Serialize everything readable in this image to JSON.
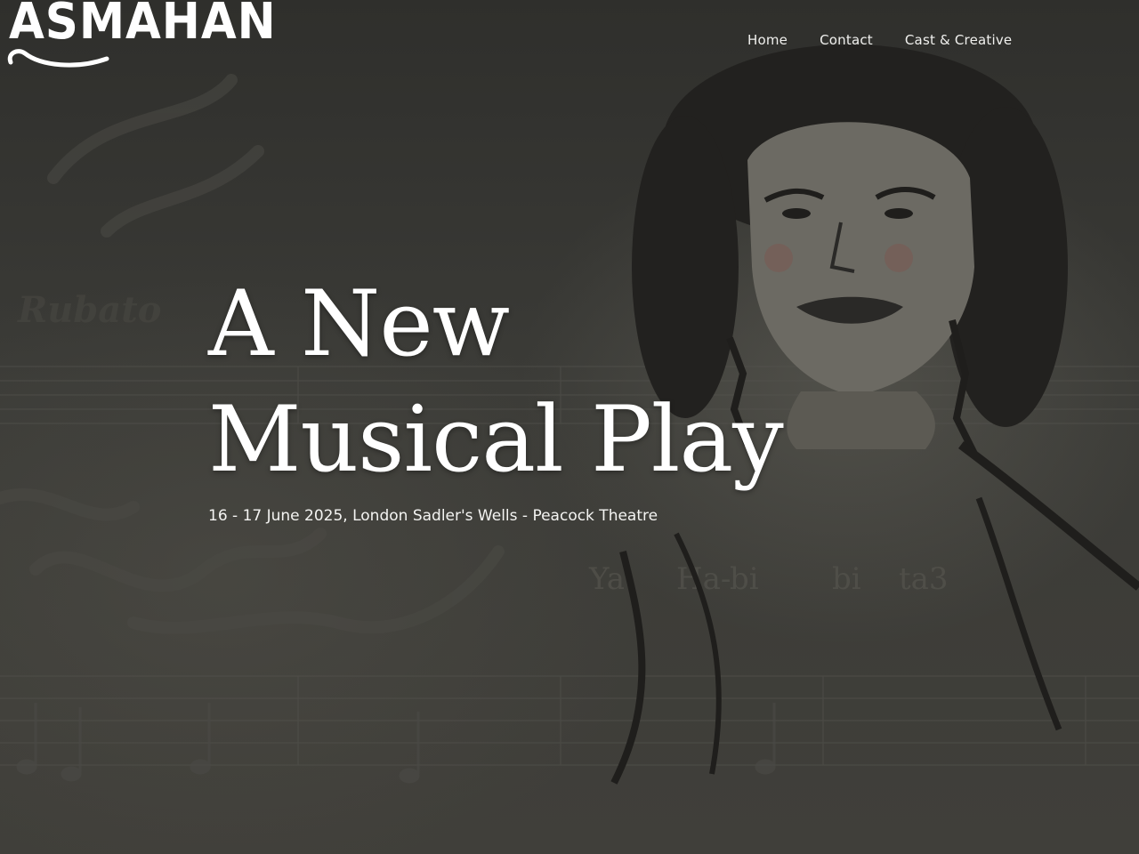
{
  "brand": {
    "logo_text": "ASMAHAN"
  },
  "nav": {
    "items": [
      "Home",
      "Contact",
      "Cast & Creative"
    ]
  },
  "hero": {
    "title_line1": "A New",
    "title_line2": "Musical Play",
    "subtitle": "16 - 17 June 2025, London Sadler's Wells - Peacock Theatre"
  },
  "background_text": {
    "tempo_marking": "Rubato",
    "lyric_syllables": [
      "Ya",
      "Ha-",
      "bi",
      "bi",
      "ta3"
    ]
  },
  "colors": {
    "background": "#3a3a36",
    "text": "#ffffff"
  },
  "icons": [
    "portrait-illustration",
    "music-staff",
    "calligraphy"
  ]
}
